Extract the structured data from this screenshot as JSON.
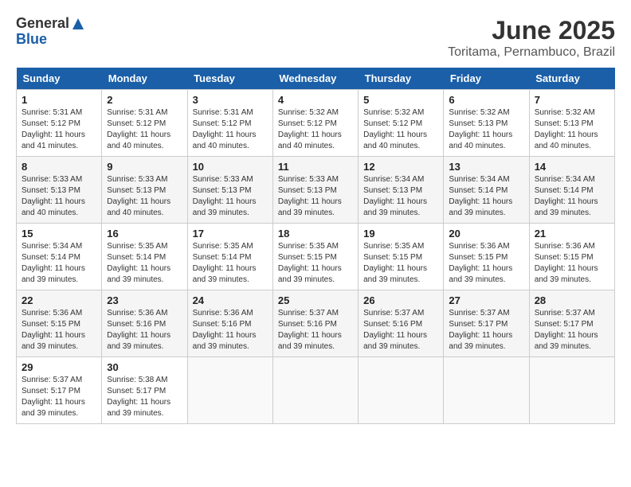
{
  "header": {
    "logo_general": "General",
    "logo_blue": "Blue",
    "month": "June 2025",
    "location": "Toritama, Pernambuco, Brazil"
  },
  "days_of_week": [
    "Sunday",
    "Monday",
    "Tuesday",
    "Wednesday",
    "Thursday",
    "Friday",
    "Saturday"
  ],
  "weeks": [
    [
      {
        "day": "1",
        "info": "Sunrise: 5:31 AM\nSunset: 5:12 PM\nDaylight: 11 hours\nand 41 minutes."
      },
      {
        "day": "2",
        "info": "Sunrise: 5:31 AM\nSunset: 5:12 PM\nDaylight: 11 hours\nand 40 minutes."
      },
      {
        "day": "3",
        "info": "Sunrise: 5:31 AM\nSunset: 5:12 PM\nDaylight: 11 hours\nand 40 minutes."
      },
      {
        "day": "4",
        "info": "Sunrise: 5:32 AM\nSunset: 5:12 PM\nDaylight: 11 hours\nand 40 minutes."
      },
      {
        "day": "5",
        "info": "Sunrise: 5:32 AM\nSunset: 5:12 PM\nDaylight: 11 hours\nand 40 minutes."
      },
      {
        "day": "6",
        "info": "Sunrise: 5:32 AM\nSunset: 5:13 PM\nDaylight: 11 hours\nand 40 minutes."
      },
      {
        "day": "7",
        "info": "Sunrise: 5:32 AM\nSunset: 5:13 PM\nDaylight: 11 hours\nand 40 minutes."
      }
    ],
    [
      {
        "day": "8",
        "info": "Sunrise: 5:33 AM\nSunset: 5:13 PM\nDaylight: 11 hours\nand 40 minutes."
      },
      {
        "day": "9",
        "info": "Sunrise: 5:33 AM\nSunset: 5:13 PM\nDaylight: 11 hours\nand 40 minutes."
      },
      {
        "day": "10",
        "info": "Sunrise: 5:33 AM\nSunset: 5:13 PM\nDaylight: 11 hours\nand 39 minutes."
      },
      {
        "day": "11",
        "info": "Sunrise: 5:33 AM\nSunset: 5:13 PM\nDaylight: 11 hours\nand 39 minutes."
      },
      {
        "day": "12",
        "info": "Sunrise: 5:34 AM\nSunset: 5:13 PM\nDaylight: 11 hours\nand 39 minutes."
      },
      {
        "day": "13",
        "info": "Sunrise: 5:34 AM\nSunset: 5:14 PM\nDaylight: 11 hours\nand 39 minutes."
      },
      {
        "day": "14",
        "info": "Sunrise: 5:34 AM\nSunset: 5:14 PM\nDaylight: 11 hours\nand 39 minutes."
      }
    ],
    [
      {
        "day": "15",
        "info": "Sunrise: 5:34 AM\nSunset: 5:14 PM\nDaylight: 11 hours\nand 39 minutes."
      },
      {
        "day": "16",
        "info": "Sunrise: 5:35 AM\nSunset: 5:14 PM\nDaylight: 11 hours\nand 39 minutes."
      },
      {
        "day": "17",
        "info": "Sunrise: 5:35 AM\nSunset: 5:14 PM\nDaylight: 11 hours\nand 39 minutes."
      },
      {
        "day": "18",
        "info": "Sunrise: 5:35 AM\nSunset: 5:15 PM\nDaylight: 11 hours\nand 39 minutes."
      },
      {
        "day": "19",
        "info": "Sunrise: 5:35 AM\nSunset: 5:15 PM\nDaylight: 11 hours\nand 39 minutes."
      },
      {
        "day": "20",
        "info": "Sunrise: 5:36 AM\nSunset: 5:15 PM\nDaylight: 11 hours\nand 39 minutes."
      },
      {
        "day": "21",
        "info": "Sunrise: 5:36 AM\nSunset: 5:15 PM\nDaylight: 11 hours\nand 39 minutes."
      }
    ],
    [
      {
        "day": "22",
        "info": "Sunrise: 5:36 AM\nSunset: 5:15 PM\nDaylight: 11 hours\nand 39 minutes."
      },
      {
        "day": "23",
        "info": "Sunrise: 5:36 AM\nSunset: 5:16 PM\nDaylight: 11 hours\nand 39 minutes."
      },
      {
        "day": "24",
        "info": "Sunrise: 5:36 AM\nSunset: 5:16 PM\nDaylight: 11 hours\nand 39 minutes."
      },
      {
        "day": "25",
        "info": "Sunrise: 5:37 AM\nSunset: 5:16 PM\nDaylight: 11 hours\nand 39 minutes."
      },
      {
        "day": "26",
        "info": "Sunrise: 5:37 AM\nSunset: 5:16 PM\nDaylight: 11 hours\nand 39 minutes."
      },
      {
        "day": "27",
        "info": "Sunrise: 5:37 AM\nSunset: 5:17 PM\nDaylight: 11 hours\nand 39 minutes."
      },
      {
        "day": "28",
        "info": "Sunrise: 5:37 AM\nSunset: 5:17 PM\nDaylight: 11 hours\nand 39 minutes."
      }
    ],
    [
      {
        "day": "29",
        "info": "Sunrise: 5:37 AM\nSunset: 5:17 PM\nDaylight: 11 hours\nand 39 minutes."
      },
      {
        "day": "30",
        "info": "Sunrise: 5:38 AM\nSunset: 5:17 PM\nDaylight: 11 hours\nand 39 minutes."
      },
      {
        "day": "",
        "info": ""
      },
      {
        "day": "",
        "info": ""
      },
      {
        "day": "",
        "info": ""
      },
      {
        "day": "",
        "info": ""
      },
      {
        "day": "",
        "info": ""
      }
    ]
  ]
}
